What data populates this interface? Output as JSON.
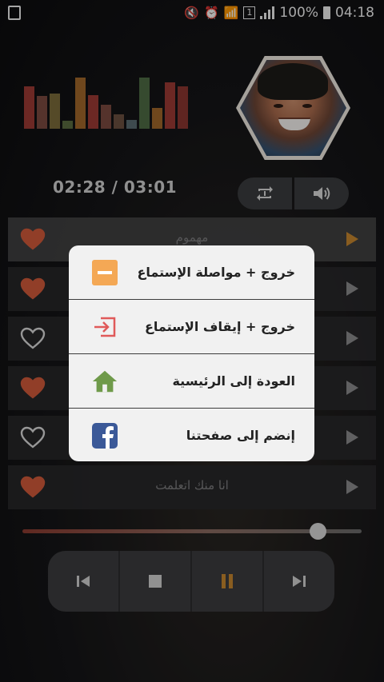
{
  "status_bar": {
    "battery": "100%",
    "time": "04:18"
  },
  "player": {
    "time_display": "02:28 / 03:01",
    "progress": 0.87,
    "visualizer_levels": [
      0.8,
      0.62,
      0.66,
      0.15,
      0.97,
      0.64,
      0.45,
      0.27,
      0.16,
      0.97,
      0.4,
      0.88,
      0.8
    ],
    "visualizer_colors": [
      "#9b3a34",
      "#7a4a40",
      "#7a6a3a",
      "#5a6a40",
      "#a0662a",
      "#9b3a34",
      "#7a4a40",
      "#6a5040",
      "#5a6a70",
      "#4e6a44",
      "#a0662a",
      "#9b3a34",
      "#8a3530"
    ]
  },
  "playlist": [
    {
      "title": "مهموم",
      "favorite": true,
      "active": true
    },
    {
      "title": "",
      "favorite": true,
      "active": false
    },
    {
      "title": "",
      "favorite": false,
      "active": false
    },
    {
      "title": "",
      "favorite": true,
      "active": false
    },
    {
      "title": "",
      "favorite": false,
      "active": false
    },
    {
      "title": "انا منك اتعلمت",
      "favorite": true,
      "active": false
    }
  ],
  "popup": {
    "items": [
      {
        "label": "خروج + مواصلة الإستماع",
        "icon": "minimize-icon",
        "color": "#f4a855"
      },
      {
        "label": "خروج + إيقاف الإستماع",
        "icon": "exit-icon",
        "color": "#e05a5a"
      },
      {
        "label": "العودة إلى الرئيسية",
        "icon": "home-icon",
        "color": "#6f9a4a"
      },
      {
        "label": "إنضم إلى صفحتنا",
        "icon": "facebook-icon",
        "color": "#3b5998"
      }
    ]
  },
  "colors": {
    "heart": "#d05a3a",
    "accent": "#c4862e"
  }
}
